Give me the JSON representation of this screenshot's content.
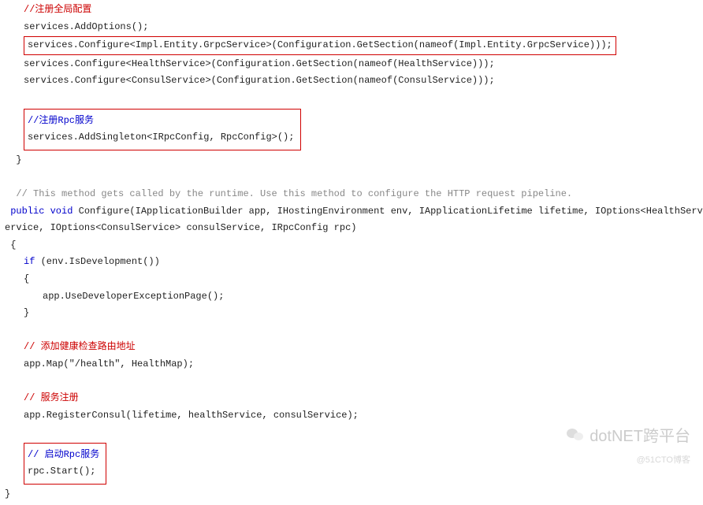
{
  "code": {
    "c1": "//注册全局配置",
    "l1": "services.AddOptions();",
    "l2": "services.Configure<Impl.Entity.GrpcService>(Configuration.GetSection(nameof(Impl.Entity.GrpcService)));",
    "l3": "services.Configure<HealthService>(Configuration.GetSection(nameof(HealthService)));",
    "l4": "services.Configure<ConsulService>(Configuration.GetSection(nameof(ConsulService)));",
    "c2": "//注册Rpc服务",
    "l5": "services.AddSingleton<IRpcConfig, RpcConfig>();",
    "brace1": "}",
    "c3": "// This method gets called by the runtime. Use this method to configure the HTTP request pipeline.",
    "l6a": " public void",
    "l6b": " Configure(IApplicationBuilder app, IHostingEnvironment env, IApplicationLifetime lifetime, IOptions<HealthService>",
    "l7": "ervice, IOptions<ConsulService> consulService, IRpcConfig rpc)",
    "brace2": " {",
    "l8a": "if",
    "l8b": " (env.IsDevelopment())",
    "brace3": "{",
    "l9": "app.UseDeveloperExceptionPage();",
    "brace4": "}",
    "c4": "// 添加健康检查路由地址",
    "l10": "app.Map(\"/health\", HealthMap);",
    "c5": "// 服务注册",
    "l11": "app.RegisterConsul(lifetime, healthService, consulService);",
    "c6": "// 启动Rpc服务",
    "l12": "rpc.Start();",
    "brace5": "}"
  },
  "watermark": {
    "main": "dotNET跨平台",
    "sub": "@51CTO博客"
  }
}
